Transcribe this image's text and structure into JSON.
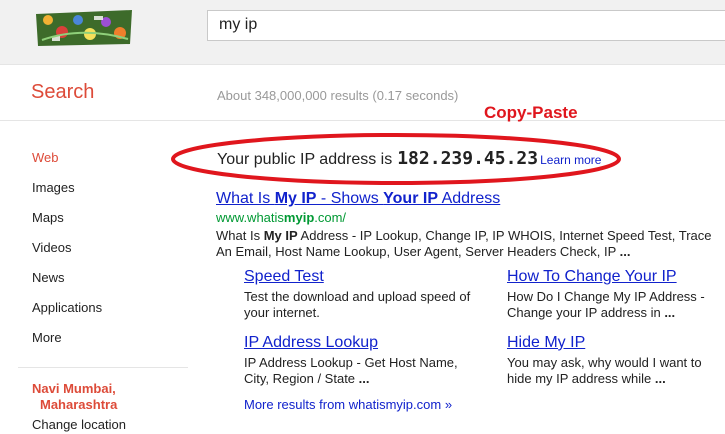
{
  "search": {
    "query": "my ip"
  },
  "header": {
    "search_label": "Search",
    "result_stats": "About 348,000,000 results (0.17 seconds)"
  },
  "annotation": {
    "text": "Copy-Paste"
  },
  "sidebar": {
    "items": [
      {
        "label": "Web",
        "active": true
      },
      {
        "label": "Images"
      },
      {
        "label": "Maps"
      },
      {
        "label": "Videos"
      },
      {
        "label": "News"
      },
      {
        "label": "Applications"
      },
      {
        "label": "More"
      }
    ],
    "location_line1": "Navi Mumbai,",
    "location_line2": "Maharashtra",
    "change_location": "Change location"
  },
  "ip_box": {
    "prefix": "Your public IP address is",
    "ip": "182.239.45.23",
    "learn_more": "Learn more"
  },
  "result": {
    "title_a": "What Is ",
    "title_b": "My IP",
    "title_c": " - Shows ",
    "title_d": "Your IP",
    "title_e": " Address",
    "url_a": "www.whatis",
    "url_b": "myip",
    "url_c": ".com/",
    "snippet_a": "What Is ",
    "snippet_b": "My IP",
    "snippet_c": " Address - IP Lookup, Change IP, IP WHOIS, Internet Speed Test, Trace An Email, Host Name Lookup, User Agent, Server Headers Check, IP ",
    "snippet_d": "...",
    "sitelinks": [
      {
        "title": "Speed Test",
        "desc": "Test the download and upload speed of your internet."
      },
      {
        "title": "How To Change Your IP",
        "desc": "How Do I Change My IP Address - Change your IP address in ",
        "ellipsis": "..."
      },
      {
        "title": "IP Address Lookup",
        "desc": "IP Address Lookup - Get Host Name, City, Region / State ",
        "ellipsis": "..."
      },
      {
        "title": "Hide My IP",
        "desc": "You may ask, why would I want to hide my IP address while ",
        "ellipsis": "..."
      }
    ],
    "more_results": "More results from whatismyip.com »"
  },
  "colors": {
    "accent": "#dd4b39",
    "link": "#1122cc",
    "url": "#009933",
    "annotation": "#e0161d"
  }
}
